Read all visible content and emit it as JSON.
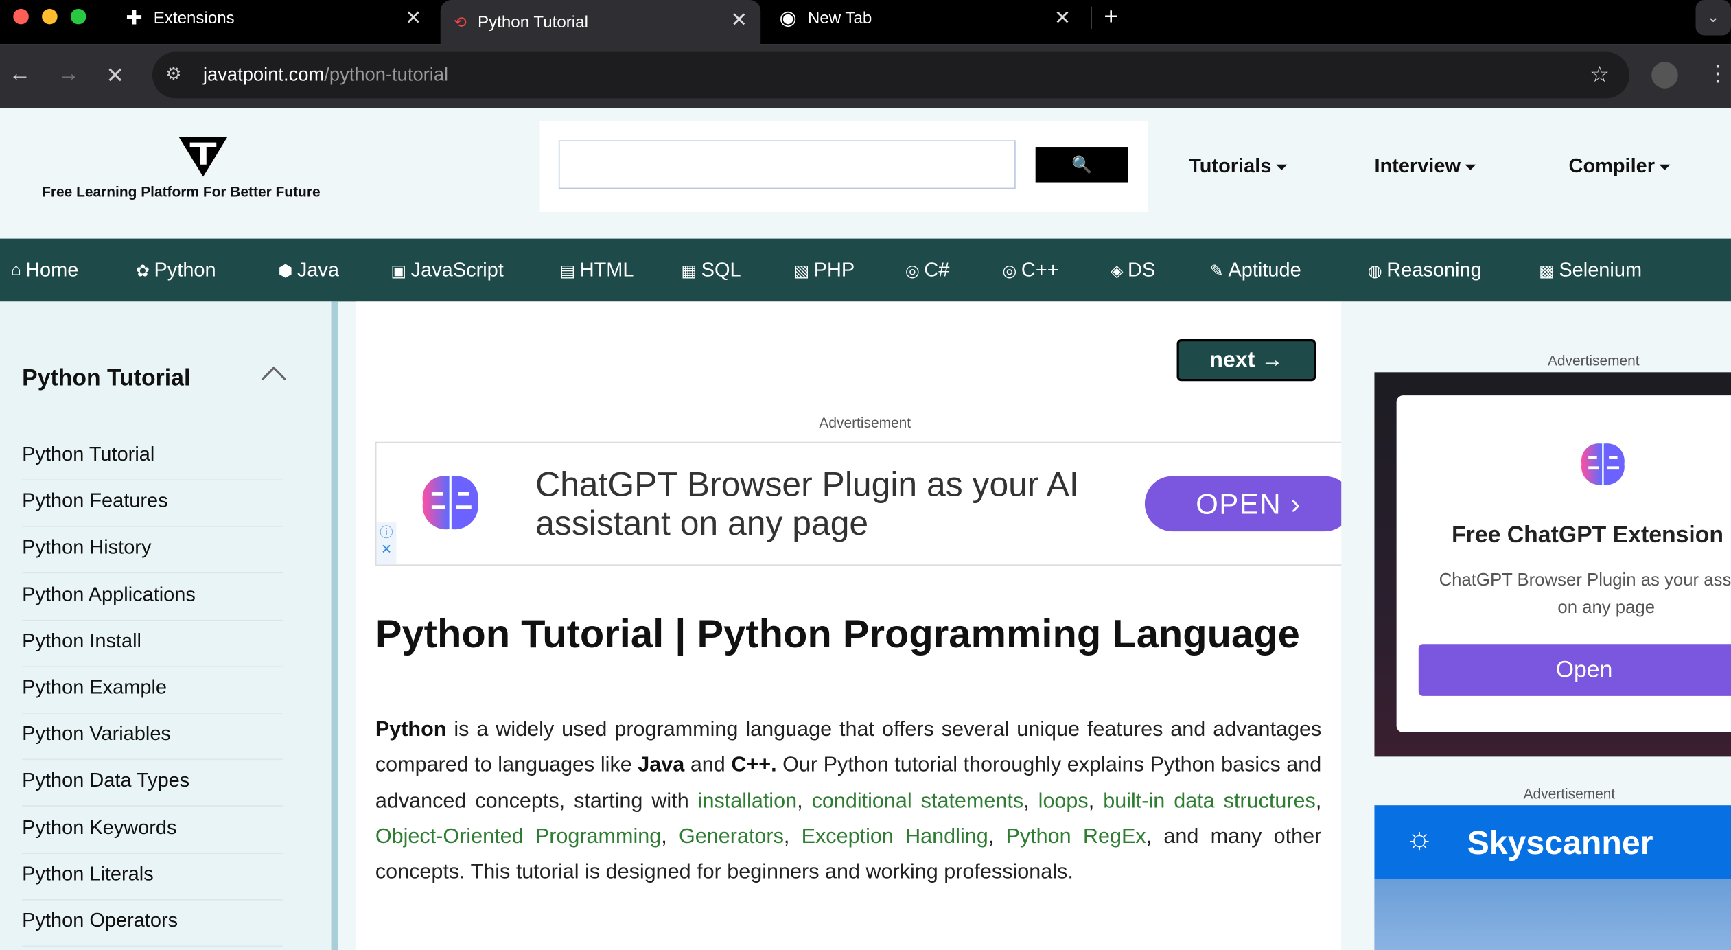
{
  "browser": {
    "tabs": [
      {
        "title": "Extensions",
        "icon": "puzzle-icon"
      },
      {
        "title": "Python Tutorial",
        "icon": "javatpoint-icon",
        "active": true
      },
      {
        "title": "New Tab",
        "icon": "chrome-icon"
      }
    ],
    "new_tab_label": "+",
    "url_domain": "javatpoint.com",
    "url_path": "/python-tutorial"
  },
  "header": {
    "tagline": "Free Learning Platform For Better Future",
    "search_button": "🔍",
    "menus": [
      "Tutorials",
      "Interview",
      "Compiler"
    ]
  },
  "topnav": [
    "Home",
    "Python",
    "Java",
    "JavaScript",
    "HTML",
    "SQL",
    "PHP",
    "C#",
    "C++",
    "DS",
    "Aptitude",
    "Reasoning",
    "Selenium"
  ],
  "sidebar": {
    "title": "Python Tutorial",
    "items": [
      "Python Tutorial",
      "Python Features",
      "Python History",
      "Python Applications",
      "Python Install",
      "Python Example",
      "Python Variables",
      "Python Data Types",
      "Python Keywords",
      "Python Literals",
      "Python Operators"
    ]
  },
  "main": {
    "next_label": "next →",
    "advertisement_label": "Advertisement",
    "ad_text": "ChatGPT Browser Plugin as your AI assistant on any page",
    "ad_button": "OPEN",
    "heading": "Python Tutorial | Python Programming Language",
    "para": {
      "p1": "Python",
      "p2": " is a widely used programming language that offers several unique features and advantages compared to languages like ",
      "p3": "Java",
      "p4": " and ",
      "p5": "C++.",
      "p6": " Our Python tutorial thoroughly explains Python basics and advanced concepts, starting with ",
      "l1": "installation",
      "l2": "conditional statements",
      "l3": "loops",
      "l4": "built-in data structures",
      "l5": "Object-Oriented Programming",
      "l6": "Generators",
      "l7": "Exception Handling",
      "l8": "Python RegEx",
      "p7": ", and many other concepts. This tutorial is designed for beginners and working professionals."
    }
  },
  "right": {
    "advertisement_label_1": "Advertisement",
    "gpt_title": "Free ChatGPT Extension",
    "gpt_sub": "ChatGPT Browser Plugin as your assistant on any page",
    "gpt_button": "Open",
    "advertisement_label_2": "Advertisement",
    "sky_name": "Skyscanner"
  }
}
